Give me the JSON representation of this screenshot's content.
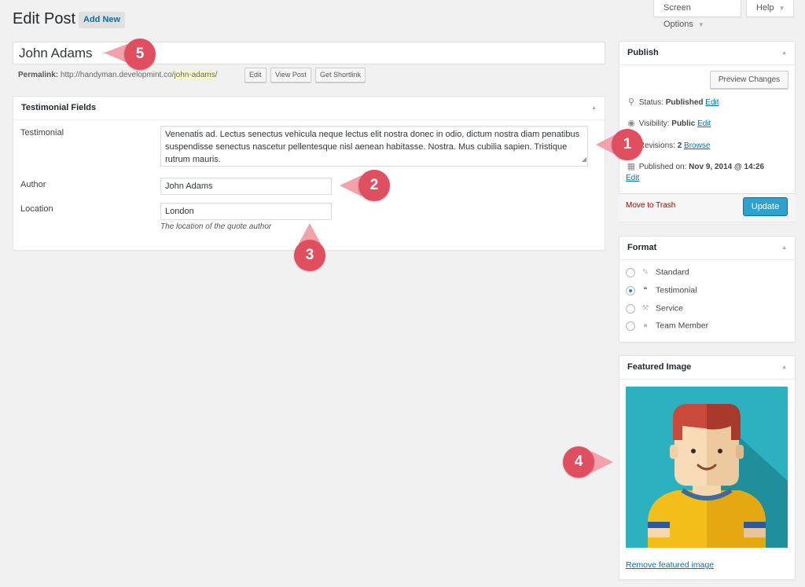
{
  "header": {
    "title": "Edit Post",
    "add_new": "Add New",
    "screen_options": "Screen Options",
    "help": "Help"
  },
  "post": {
    "title": "John Adams",
    "permalink_label": "Permalink:",
    "permalink_base": "http://handyman.developmint.co/",
    "permalink_slug": "john-adams",
    "permalink_end": "/",
    "edit_btn": "Edit",
    "view_btn": "View Post",
    "shortlink_btn": "Get Shortlink"
  },
  "testimonial_box": {
    "title": "Testimonial Fields",
    "testimonial_label": "Testimonial",
    "testimonial_value": "Venenatis ad. Lectus senectus vehicula neque lectus elit nostra donec in odio, dictum nostra diam penatibus suspendisse senectus nascetur pellentesque nisl aenean habitasse. Nostra. Mus cubilia sapien. Tristique rutrum mauris.",
    "author_label": "Author",
    "author_value": "John Adams",
    "location_label": "Location",
    "location_value": "London",
    "location_desc": "The location of the quote author"
  },
  "publish": {
    "title": "Publish",
    "preview": "Preview Changes",
    "status_label": "Status:",
    "status_value": "Published",
    "visibility_label": "Visibility:",
    "visibility_value": "Public",
    "revisions_label": "Revisions:",
    "revisions_value": "2",
    "browse": "Browse",
    "published_label": "Published on:",
    "published_value": "Nov 9, 2014 @ 14:26",
    "edit": "Edit",
    "trash": "Move to Trash",
    "update": "Update"
  },
  "format": {
    "title": "Format",
    "options": [
      {
        "label": "Standard",
        "icon": "pin-icon",
        "selected": false
      },
      {
        "label": "Testimonial",
        "icon": "quote-bubbles-icon",
        "selected": true
      },
      {
        "label": "Service",
        "icon": "hammer-icon",
        "selected": false
      },
      {
        "label": "Team Member",
        "icon": "person-icon",
        "selected": false
      }
    ]
  },
  "featured": {
    "title": "Featured Image",
    "remove": "Remove featured image"
  },
  "callouts": [
    "1",
    "2",
    "3",
    "4",
    "5"
  ],
  "colors": {
    "accent": "#0073aa",
    "update": "#2ea2cc",
    "callout": "#e04f5f",
    "trash": "#aa0000",
    "image_bg": "#2bb1c0"
  }
}
